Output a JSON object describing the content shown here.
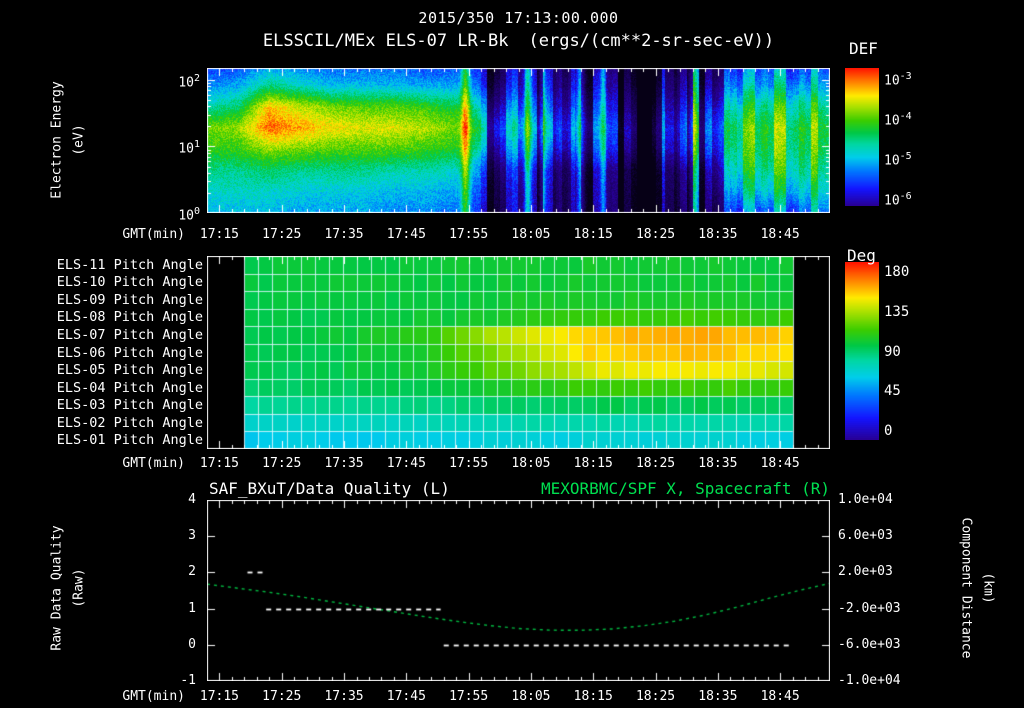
{
  "header": {
    "datetime_title": "2015/350 17:13:00.000",
    "spectrogram_title": "ELSSCIL/MEx ELS-07 LR-Bk",
    "spectrogram_units": "(ergs/(cm**2-sr-sec-eV))"
  },
  "axis": {
    "gmt_label": "GMT(min)",
    "time_ticks": [
      "17:15",
      "17:25",
      "17:35",
      "17:45",
      "17:55",
      "18:05",
      "18:15",
      "18:25",
      "18:35",
      "18:45"
    ],
    "time_tick_minutes": [
      2,
      12,
      22,
      32,
      42,
      52,
      62,
      72,
      82,
      92
    ],
    "start_time": "17:13",
    "span_minutes": 100
  },
  "panel1": {
    "ylabel_line1": "Electron Energy",
    "ylabel_line2": "(eV)",
    "ytick_base": "10",
    "ytick_exponents": [
      "2",
      "1",
      "0"
    ],
    "colorbar": {
      "label": "DEF",
      "tick_base": "10",
      "tick_exponents": [
        "-3",
        "-4",
        "-5",
        "-6"
      ]
    }
  },
  "panel2": {
    "row_labels": [
      "ELS-11 Pitch Angle",
      "ELS-10 Pitch Angle",
      "ELS-09 Pitch Angle",
      "ELS-08 Pitch Angle",
      "ELS-07 Pitch Angle",
      "ELS-06 Pitch Angle",
      "ELS-05 Pitch Angle",
      "ELS-04 Pitch Angle",
      "ELS-03 Pitch Angle",
      "ELS-02 Pitch Angle",
      "ELS-01 Pitch Angle"
    ],
    "colorbar": {
      "label": "Deg",
      "ticks": [
        "180",
        "135",
        "90",
        "45",
        "0"
      ]
    }
  },
  "panel3": {
    "title_left": "SAF_BXuT/Data Quality (L)",
    "title_right": "MEXORBMC/SPF X, Spacecraft (R)",
    "ylabel_left_line1": "Raw Data Quality",
    "ylabel_left_line2": "(Raw)",
    "yticks_left": [
      "4",
      "3",
      "2",
      "1",
      "0",
      "-1"
    ],
    "ylabel_right_line1": "Component Distance",
    "ylabel_right_line2": "(km)",
    "yticks_right": [
      "1.0e+04",
      "6.0e+03",
      "2.0e+03",
      "-2.0e+03",
      "-6.0e+03",
      "-1.0e+04"
    ]
  },
  "colors": {
    "background": "#000000",
    "foreground": "#ffffff",
    "right_title_green": "#00e050",
    "spacecraft_curve_green": "#00b840",
    "quality_line_white": "#ffffff",
    "colormap_stops": [
      [
        0.0,
        40,
        0,
        150
      ],
      [
        0.12,
        20,
        20,
        255
      ],
      [
        0.25,
        0,
        120,
        255
      ],
      [
        0.35,
        0,
        205,
        235
      ],
      [
        0.45,
        0,
        215,
        160
      ],
      [
        0.53,
        0,
        200,
        70
      ],
      [
        0.62,
        60,
        205,
        0
      ],
      [
        0.72,
        170,
        225,
        0
      ],
      [
        0.8,
        255,
        235,
        0
      ],
      [
        0.89,
        255,
        140,
        0
      ],
      [
        1.0,
        255,
        20,
        0
      ]
    ]
  },
  "chart_data": [
    {
      "type": "heatmap",
      "name": "electron-energy-spectrogram",
      "title": "ELSSCIL/MEx ELS-07 LR-Bk (ergs/(cm**2-sr-sec-eV))",
      "xlabel": "GMT(min)",
      "ylabel": "Electron Energy (eV)",
      "x_start": "2015/350 17:13:00.000",
      "x_range_minutes": [
        0,
        100
      ],
      "y_scale": "log",
      "energy_range_ev": [
        1,
        151
      ],
      "log_energy_top": 2.18,
      "value_label": "log10 DEF ergs/(cm**2-sr-sec-eV)",
      "value_range": [
        -6,
        -3
      ],
      "t_minutes": [
        0,
        5,
        10,
        15,
        20,
        25,
        30,
        35,
        40,
        45,
        50,
        55,
        60,
        65,
        70,
        75,
        80,
        85,
        90,
        95,
        100
      ],
      "log_energy_levels": [
        0,
        0.32,
        0.64,
        0.96,
        1.28,
        1.6,
        1.92,
        2.25
      ],
      "grid": [
        [
          -5.0,
          -5.0,
          -5.0,
          -5.1,
          -5.1,
          -5.1,
          -5.2,
          -5.2,
          -5.3,
          -5.6,
          -5.9,
          -6.0,
          -6.0,
          -6.0,
          -6.0,
          -6.0,
          -5.9,
          -5.3,
          -5.1,
          -5.2,
          -5.3
        ],
        [
          -4.8,
          -4.8,
          -4.8,
          -4.9,
          -4.9,
          -4.9,
          -5.0,
          -5.0,
          -5.1,
          -5.5,
          -5.9,
          -6.0,
          -6.0,
          -6.0,
          -6.0,
          -5.9,
          -5.8,
          -4.8,
          -4.6,
          -4.7,
          -4.9
        ],
        [
          -4.6,
          -4.6,
          -4.5,
          -4.6,
          -4.6,
          -4.6,
          -4.7,
          -4.7,
          -4.8,
          -5.3,
          -5.7,
          -5.9,
          -5.9,
          -5.9,
          -5.9,
          -5.8,
          -5.6,
          -4.5,
          -4.3,
          -4.4,
          -4.7
        ],
        [
          -4.2,
          -4.2,
          -3.9,
          -4.0,
          -4.1,
          -4.1,
          -4.1,
          -4.2,
          -4.3,
          -4.8,
          -5.2,
          -5.4,
          -5.4,
          -5.4,
          -5.4,
          -5.3,
          -5.1,
          -4.3,
          -4.1,
          -4.2,
          -4.5
        ],
        [
          -4.0,
          -3.9,
          -3.2,
          -3.4,
          -3.6,
          -3.7,
          -3.7,
          -3.8,
          -4.0,
          -4.5,
          -4.9,
          -5.1,
          -5.2,
          -5.2,
          -5.2,
          -5.1,
          -4.9,
          -4.2,
          -4.0,
          -4.1,
          -4.4
        ],
        [
          -4.7,
          -4.5,
          -3.5,
          -3.8,
          -4.0,
          -4.1,
          -4.1,
          -4.2,
          -4.4,
          -4.9,
          -5.3,
          -5.5,
          -5.5,
          -5.5,
          -5.5,
          -5.4,
          -5.2,
          -4.5,
          -4.3,
          -4.4,
          -4.7
        ],
        [
          -5.2,
          -5.1,
          -4.6,
          -4.8,
          -5.0,
          -5.0,
          -5.0,
          -5.1,
          -5.1,
          -5.4,
          -5.7,
          -5.8,
          -5.8,
          -5.8,
          -5.8,
          -5.7,
          -5.6,
          -5.0,
          -4.8,
          -4.9,
          -5.2
        ],
        [
          -5.6,
          -5.5,
          -5.2,
          -5.3,
          -5.4,
          -5.4,
          -5.4,
          -5.5,
          -5.5,
          -5.7,
          -5.9,
          -6.0,
          -6.0,
          -6.0,
          -6.0,
          -5.9,
          -5.8,
          -5.4,
          -5.2,
          -5.3,
          -5.6
        ]
      ],
      "noise": 0.22,
      "stripe_regions": [
        {
          "t0": 44,
          "t1": 85,
          "p": 0.28,
          "dark": 1.2,
          "bright": 0.45
        },
        {
          "t0": 85,
          "t1": 97,
          "p": 0.1,
          "dark": 0.7,
          "bright": 0.5
        }
      ],
      "bright_lines": [
        {
          "t": 41.5,
          "w": 0.7,
          "amp": 1.1
        },
        {
          "t": 51.5,
          "w": 0.6,
          "amp": 1.2
        },
        {
          "t": 53.8,
          "w": 0.5,
          "amp": 0.9
        },
        {
          "t": 60.0,
          "w": 0.7,
          "amp": 1.1
        },
        {
          "t": 63.6,
          "w": 0.5,
          "amp": 0.8
        },
        {
          "t": 78.0,
          "w": 0.8,
          "amp": 1.0
        }
      ],
      "dark_bands": [
        {
          "t0": 55.5,
          "t1": 58.5,
          "amp": 0.9
        },
        {
          "t0": 66.0,
          "t1": 71.5,
          "amp": 1.1
        },
        {
          "t0": 73.5,
          "t1": 76.0,
          "amp": 0.9
        }
      ]
    },
    {
      "type": "heatmap",
      "name": "pitch-angle-grid",
      "unit": "deg",
      "value_range": [
        0,
        180
      ],
      "t_range": [
        6,
        94
      ],
      "n_cols": 39,
      "t_points": [
        6,
        20,
        35,
        48,
        62,
        78,
        94
      ],
      "rows": [
        {
          "label": "ELS-11 Pitch Angle",
          "values": [
            97,
            97,
            98,
            99,
            100,
            100,
            99
          ]
        },
        {
          "label": "ELS-10 Pitch Angle",
          "values": [
            96,
            97,
            97,
            99,
            100,
            100,
            99
          ]
        },
        {
          "label": "ELS-09 Pitch Angle",
          "values": [
            96,
            96,
            97,
            100,
            102,
            102,
            101
          ]
        },
        {
          "label": "ELS-08 Pitch Angle",
          "values": [
            95,
            96,
            98,
            103,
            109,
            111,
            109
          ]
        },
        {
          "label": "ELS-07 Pitch Angle",
          "values": [
            95,
            97,
            106,
            133,
            152,
            155,
            150
          ]
        },
        {
          "label": "ELS-06 Pitch Angle",
          "values": [
            94,
            96,
            103,
            127,
            148,
            152,
            147
          ]
        },
        {
          "label": "ELS-05 Pitch Angle",
          "values": [
            92,
            94,
            100,
            118,
            139,
            143,
            138
          ]
        },
        {
          "label": "ELS-04 Pitch Angle",
          "values": [
            90,
            91,
            95,
            103,
            110,
            112,
            109
          ]
        },
        {
          "label": "ELS-03 Pitch Angle",
          "values": [
            82,
            83,
            86,
            90,
            93,
            93,
            91
          ]
        },
        {
          "label": "ELS-02 Pitch Angle",
          "values": [
            72,
            73,
            75,
            77,
            79,
            79,
            78
          ]
        },
        {
          "label": "ELS-01 Pitch Angle",
          "values": [
            63,
            64,
            65,
            67,
            68,
            68,
            67
          ]
        }
      ]
    },
    {
      "type": "line",
      "name": "quality-and-distance",
      "xlabel": "GMT(min)",
      "x_range_minutes": [
        0,
        100
      ],
      "left_axis": {
        "label": "Raw Data Quality (Raw)",
        "range": [
          -1,
          4
        ],
        "tick_values": [
          4,
          3,
          2,
          1,
          0,
          -1
        ]
      },
      "right_axis": {
        "label": "Component Distance (km)",
        "range": [
          -10000,
          10000
        ],
        "tick_values": [
          10000,
          6000,
          2000,
          -2000,
          -6000,
          -10000
        ]
      },
      "series": [
        {
          "name": "SAF_BXuT/Data Quality",
          "axis": "left",
          "style": "dashed",
          "segments": [
            {
              "value": 2,
              "t0": 6.5,
              "t1": 9
            },
            {
              "value": 1,
              "t0": 9.5,
              "t1": 37.5
            },
            {
              "value": 0,
              "t0": 38,
              "t1": 93.5
            }
          ]
        },
        {
          "name": "MEXORBMC/SPF X, Spacecraft",
          "axis": "right",
          "style": "dashed",
          "t": [
            0,
            5,
            10,
            15,
            20,
            25,
            30,
            35,
            40,
            45,
            50,
            55,
            60,
            65,
            70,
            75,
            80,
            85,
            90,
            95,
            100
          ],
          "values": [
            700,
            250,
            -200,
            -700,
            -1250,
            -1800,
            -2350,
            -2900,
            -3400,
            -3850,
            -4200,
            -4380,
            -4400,
            -4250,
            -3900,
            -3400,
            -2700,
            -1850,
            -900,
            0,
            800
          ]
        }
      ]
    }
  ]
}
